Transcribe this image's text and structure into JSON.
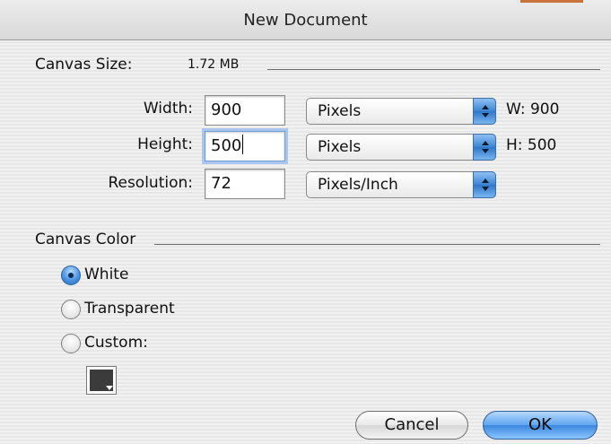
{
  "window": {
    "title": "New Document"
  },
  "canvas_size": {
    "label": "Canvas Size:",
    "value": "1.72 MB"
  },
  "dimensions": {
    "width": {
      "label": "Width:",
      "value": "900",
      "unit": "Pixels",
      "readout": "W: 900"
    },
    "height": {
      "label": "Height:",
      "value": "500",
      "unit": "Pixels",
      "readout": "H: 500"
    },
    "resolution": {
      "label": "Resolution:",
      "value": "72",
      "unit": "Pixels/Inch"
    }
  },
  "canvas_color": {
    "label": "Canvas Color",
    "options": [
      {
        "label": "White",
        "selected": true
      },
      {
        "label": "Transparent",
        "selected": false
      },
      {
        "label": "Custom:",
        "selected": false
      }
    ],
    "custom_swatch_color": "#3b3b3b"
  },
  "buttons": {
    "cancel": "Cancel",
    "ok": "OK"
  },
  "colors": {
    "accent": "#3b86df",
    "focus_ring": "#a9c7ee"
  }
}
